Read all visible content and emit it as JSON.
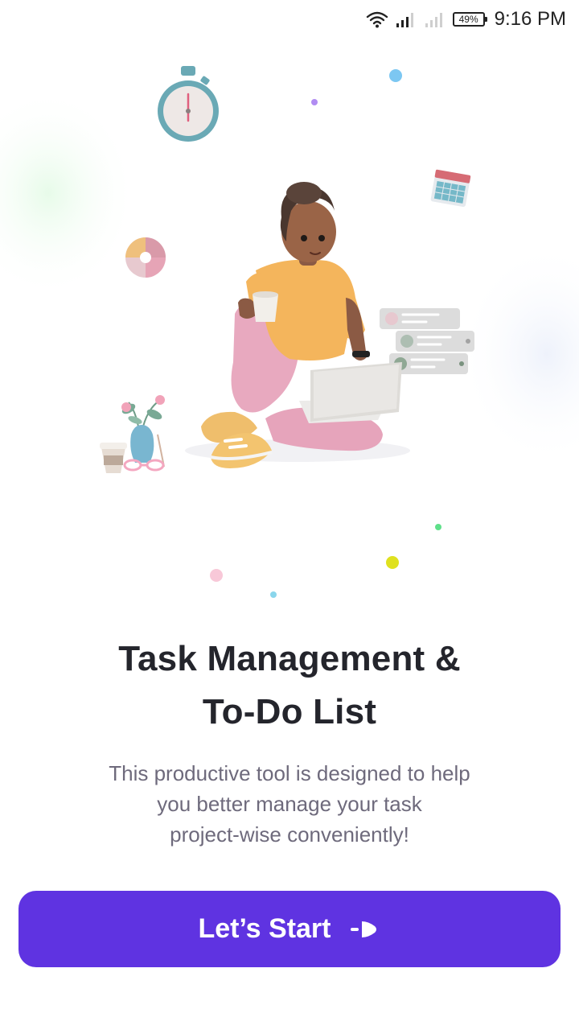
{
  "status_bar": {
    "battery": "49%",
    "time": "9:16 PM"
  },
  "onboarding": {
    "title_line1": "Task Management &",
    "title_line2": "To-Do List",
    "description_line1": "This productive tool is designed to help",
    "description_line2": "you better manage your task",
    "description_line3": "project-wise conveniently!",
    "start_button_label": "Let’s Start"
  },
  "colors": {
    "primary": "#5f33e1",
    "title": "#24252c",
    "body_text": "#6e6a7c",
    "background": "#ffffff"
  },
  "icons": [
    "wifi-icon",
    "signal-icon",
    "battery-icon",
    "arrow-right-icon"
  ]
}
